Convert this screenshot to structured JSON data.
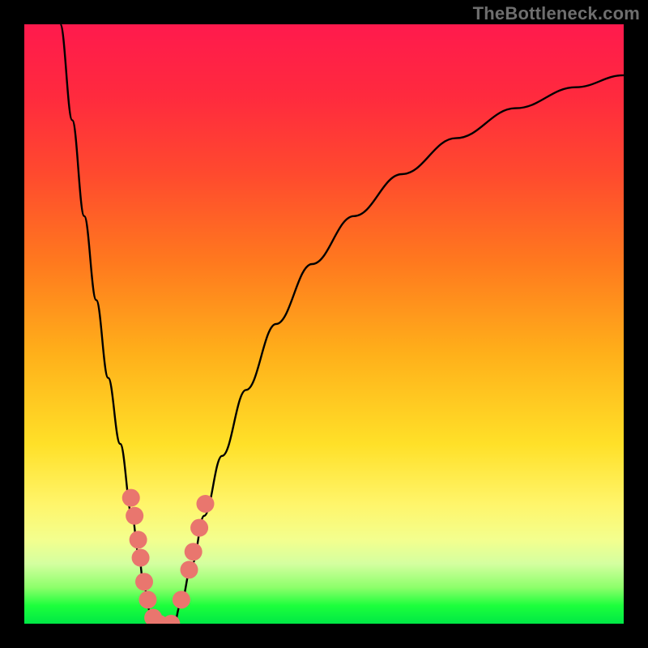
{
  "watermark": "TheBottleneck.com",
  "chart_data": {
    "type": "line",
    "title": "",
    "xlabel": "",
    "ylabel": "",
    "xlim": [
      0,
      100
    ],
    "ylim": [
      0,
      100
    ],
    "series": [
      {
        "name": "curve-left",
        "x": [
          6,
          8,
          10,
          12,
          14,
          16,
          18,
          19,
          20,
          21,
          22
        ],
        "y": [
          100,
          84,
          68,
          54,
          41,
          30,
          18,
          12,
          6,
          2,
          0
        ]
      },
      {
        "name": "curve-right",
        "x": [
          25,
          26,
          28,
          30,
          33,
          37,
          42,
          48,
          55,
          63,
          72,
          82,
          92,
          100
        ],
        "y": [
          0,
          3,
          10,
          18,
          28,
          39,
          50,
          60,
          68,
          75,
          81,
          86,
          89.5,
          91.5
        ]
      }
    ],
    "markers": {
      "name": "highlight-dots",
      "color": "#e9766e",
      "points": [
        {
          "x": 17.8,
          "y": 21
        },
        {
          "x": 18.4,
          "y": 18
        },
        {
          "x": 19.0,
          "y": 14
        },
        {
          "x": 19.4,
          "y": 11
        },
        {
          "x": 20.0,
          "y": 7
        },
        {
          "x": 20.6,
          "y": 4
        },
        {
          "x": 21.5,
          "y": 1
        },
        {
          "x": 22.5,
          "y": 0
        },
        {
          "x": 24.5,
          "y": 0
        },
        {
          "x": 26.2,
          "y": 4
        },
        {
          "x": 27.5,
          "y": 9
        },
        {
          "x": 28.2,
          "y": 12
        },
        {
          "x": 29.2,
          "y": 16
        },
        {
          "x": 30.2,
          "y": 20
        }
      ]
    },
    "gradient_stops": [
      {
        "pos": 0,
        "color": "#ff1a4d"
      },
      {
        "pos": 12,
        "color": "#ff2a3e"
      },
      {
        "pos": 25,
        "color": "#ff4a2e"
      },
      {
        "pos": 40,
        "color": "#ff7a1e"
      },
      {
        "pos": 55,
        "color": "#ffb01a"
      },
      {
        "pos": 70,
        "color": "#ffe028"
      },
      {
        "pos": 80,
        "color": "#fff56a"
      },
      {
        "pos": 86,
        "color": "#f3ff8e"
      },
      {
        "pos": 90,
        "color": "#d4ffa0"
      },
      {
        "pos": 94,
        "color": "#8cff6a"
      },
      {
        "pos": 97,
        "color": "#1cff3c"
      },
      {
        "pos": 100,
        "color": "#00e845"
      }
    ]
  }
}
